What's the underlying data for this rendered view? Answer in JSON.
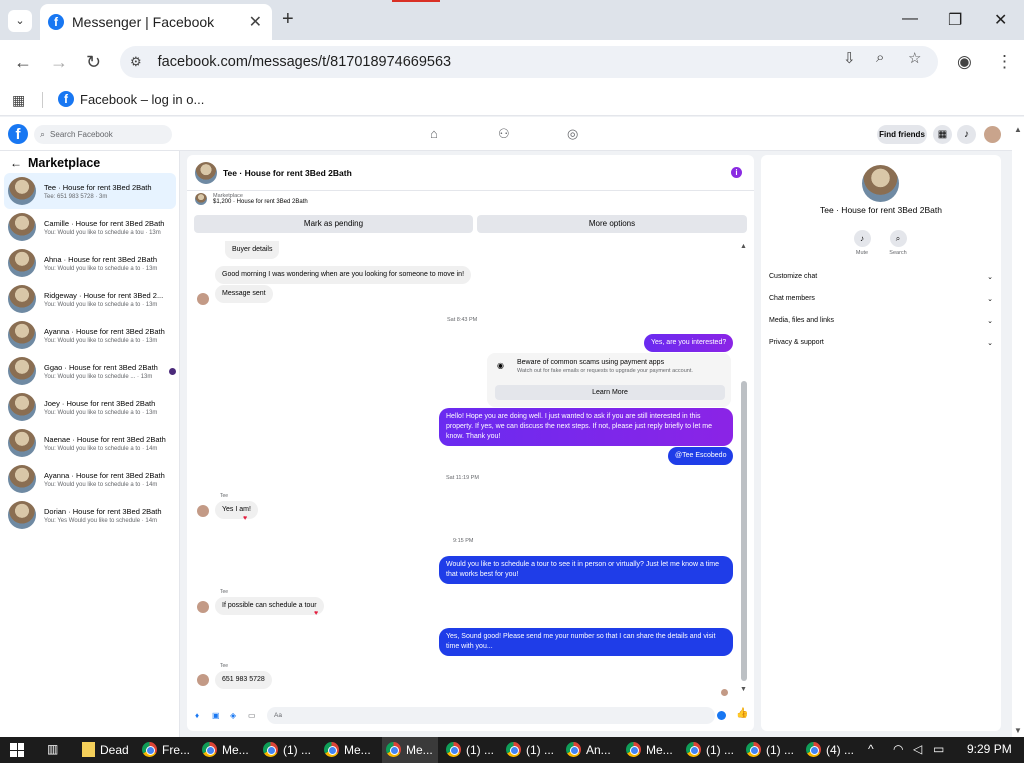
{
  "browser": {
    "tab_title": "Messenger | Facebook",
    "url": "facebook.com/messages/t/817018974669563",
    "bookmark": "Facebook – log in o..."
  },
  "fbnav": {
    "search_placeholder": "Search Facebook",
    "find_friends": "Find friends"
  },
  "sidebar": {
    "title": "Marketplace",
    "conversations": [
      {
        "name": "Tee · House for rent 3Bed 2Bath",
        "snippet": "Tee: 651 983 5728 · 3m"
      },
      {
        "name": "Camille · House for rent 3Bed 2Bath",
        "snippet": "You: Would you like to schedule a tou · 13m"
      },
      {
        "name": "Ahna · House for rent 3Bed 2Bath",
        "snippet": "You: Would you like to schedule a to · 13m"
      },
      {
        "name": "Ridgeway · House for rent 3Bed 2...",
        "snippet": "You: Would you like to schedule a to · 13m"
      },
      {
        "name": "Ayanna · House for rent 3Bed 2Bath",
        "snippet": "You: Would you like to schedule a to · 13m"
      },
      {
        "name": "Ggao · House for rent 3Bed 2Bath",
        "snippet": "You: Would you like to schedule ... · 13m"
      },
      {
        "name": "Joey · House for rent 3Bed 2Bath",
        "snippet": "You: Would you like to schedule a to · 13m"
      },
      {
        "name": "Naenae · House for rent 3Bed 2Bath",
        "snippet": "You: Would you like to schedule a to · 14m"
      },
      {
        "name": "Ayanna · House for rent 3Bed 2Bath",
        "snippet": "You: Would you like to schedule a to · 14m"
      },
      {
        "name": "Dorian · House for rent 3Bed 2Bath",
        "snippet": "You: Yes Would you like to schedule · 14m"
      }
    ]
  },
  "chat": {
    "title": "Tee · House for rent 3Bed 2Bath",
    "listing_source": "Marketplace",
    "listing_line": "$1,200 · House for rent 3Bed 2Bath",
    "mark_pending": "Mark as pending",
    "more_options": "More options",
    "buyer_details": "Buyer details",
    "messages": {
      "m1": "Good morning I was wondering when are you looking for someone to move in!",
      "m2": "Message sent",
      "t1": "Sat 8:43 PM",
      "m3": "Yes, are you interested?",
      "scam_title": "Beware of common scams using payment apps",
      "scam_sub": "Watch out for fake emails or requests to upgrade your payment account.",
      "learn_more": "Learn More",
      "m4": "Hello! Hope you are doing well. I just wanted to ask if you are still interested in this property. If yes, we can discuss the next steps. If not, please just reply briefly to let me know. Thank you!",
      "m5": "@Tee Escobedo",
      "t2": "Sat 11:19 PM",
      "sender": "Tee",
      "m6": "Yes I am!",
      "t3": "9:15 PM",
      "m7": "Would you like to schedule a tour to see it in person or virtually? Just let me know a time that works best for you!",
      "m8": "If possible can schedule a tour",
      "m9": "Yes, Sound good! Please send me your number so that I can share the details and visit time with you...",
      "m10": "651 983 5728"
    },
    "compose_placeholder": "Aa"
  },
  "info_panel": {
    "name": "Tee · House for rent 3Bed 2Bath",
    "mute": "Mute",
    "search": "Search",
    "sections": [
      "Customize chat",
      "Chat members",
      "Media, files and links",
      "Privacy & support"
    ]
  },
  "taskbar": {
    "items": [
      "Dead",
      "Fre...",
      "Me...",
      "(1) ...",
      "Me...",
      "Me...",
      "(1) ...",
      "(1) ...",
      "An...",
      "Me...",
      "(1) ...",
      "(1) ...",
      "(4) ..."
    ],
    "time": "9:29 PM"
  }
}
